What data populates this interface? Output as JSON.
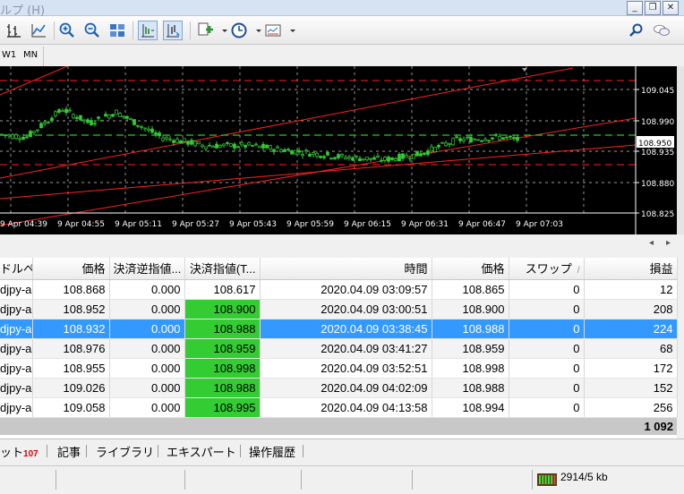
{
  "window": {
    "menu_text": "ルプ (H)"
  },
  "timeframes": [
    "W1",
    "MN"
  ],
  "chart": {
    "price_labels": [
      "109.045",
      "108.990",
      "108.950",
      "108.935",
      "108.880",
      "108.825"
    ],
    "current_price": "108.950",
    "time_labels": [
      "9 Apr 04:39",
      "9 Apr 04:55",
      "9 Apr 05:11",
      "9 Apr 05:27",
      "9 Apr 05:43",
      "9 Apr 05:59",
      "9 Apr 06:15",
      "9 Apr 06:31",
      "9 Apr 06:47",
      "9 Apr 07:03"
    ],
    "colors": {
      "background": "#000000",
      "candles": "#33cc33",
      "trendlines": "#ff2020",
      "grid": "#cfcfcf",
      "bid_line": "#22cc22"
    }
  },
  "table": {
    "headers": [
      "ドルペア",
      "価格",
      "決済逆指値...",
      "決済指値(T...",
      "時間",
      "価格",
      "スワップ",
      "損益"
    ],
    "rows": [
      {
        "symbol": "djpy-a",
        "open_price": "108.868",
        "sl": "0.000",
        "tp": "108.617",
        "time": "2020.04.09 03:09:57",
        "price": "108.865",
        "swap": "0",
        "profit": "12",
        "tp_highlight": false,
        "selected": false
      },
      {
        "symbol": "djpy-a",
        "open_price": "108.952",
        "sl": "0.000",
        "tp": "108.900",
        "time": "2020.04.09 03:00:51",
        "price": "108.900",
        "swap": "0",
        "profit": "208",
        "tp_highlight": true,
        "selected": false
      },
      {
        "symbol": "djpy-a",
        "open_price": "108.932",
        "sl": "0.000",
        "tp": "108.988",
        "time": "2020.04.09 03:38:45",
        "price": "108.988",
        "swap": "0",
        "profit": "224",
        "tp_highlight": true,
        "selected": true
      },
      {
        "symbol": "djpy-a",
        "open_price": "108.976",
        "sl": "0.000",
        "tp": "108.959",
        "time": "2020.04.09 03:41:27",
        "price": "108.959",
        "swap": "0",
        "profit": "68",
        "tp_highlight": true,
        "selected": false
      },
      {
        "symbol": "djpy-a",
        "open_price": "108.955",
        "sl": "0.000",
        "tp": "108.998",
        "time": "2020.04.09 03:52:51",
        "price": "108.998",
        "swap": "0",
        "profit": "172",
        "tp_highlight": true,
        "selected": false
      },
      {
        "symbol": "djpy-a",
        "open_price": "109.026",
        "sl": "0.000",
        "tp": "108.988",
        "time": "2020.04.09 04:02:09",
        "price": "108.988",
        "swap": "0",
        "profit": "152",
        "tp_highlight": true,
        "selected": false
      },
      {
        "symbol": "djpy-a",
        "open_price": "109.058",
        "sl": "0.000",
        "tp": "108.995",
        "time": "2020.04.09 04:13:58",
        "price": "108.994",
        "swap": "0",
        "profit": "256",
        "tp_highlight": true,
        "selected": false
      }
    ],
    "total_profit": "1 092"
  },
  "bottom_tabs": [
    {
      "label": "ット",
      "count": "107"
    },
    {
      "label": "記事"
    },
    {
      "label": "ライブラリ"
    },
    {
      "label": "エキスパート"
    },
    {
      "label": "操作履歴"
    }
  ],
  "status": {
    "traffic": "2914/5 kb"
  }
}
